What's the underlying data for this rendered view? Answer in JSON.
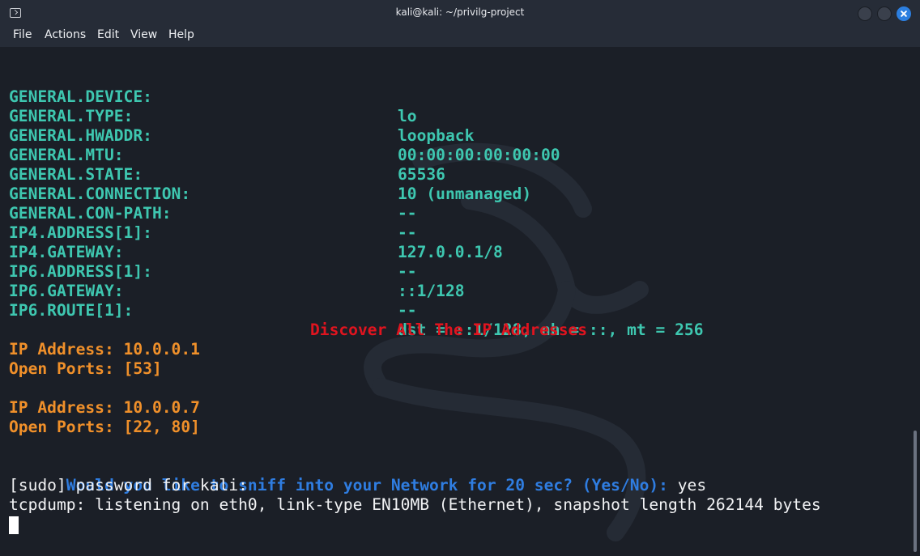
{
  "window": {
    "title": "kali@kali: ~/privilg-project",
    "icon": "terminal-icon"
  },
  "menu": [
    "File",
    "Actions",
    "Edit",
    "View",
    "Help"
  ],
  "device_info": [
    {
      "key": "GENERAL.DEVICE:",
      "value": "lo"
    },
    {
      "key": "GENERAL.TYPE:",
      "value": "loopback"
    },
    {
      "key": "GENERAL.HWADDR:",
      "value": "00:00:00:00:00:00"
    },
    {
      "key": "GENERAL.MTU:",
      "value": "65536"
    },
    {
      "key": "GENERAL.STATE:",
      "value": "10 (unmanaged)"
    },
    {
      "key": "GENERAL.CONNECTION:",
      "value": "--"
    },
    {
      "key": "GENERAL.CON-PATH:",
      "value": "--"
    },
    {
      "key": "IP4.ADDRESS[1]:",
      "value": "127.0.0.1/8"
    },
    {
      "key": "IP4.GATEWAY:",
      "value": "--"
    },
    {
      "key": "IP6.ADDRESS[1]:",
      "value": "::1/128"
    },
    {
      "key": "IP6.GATEWAY:",
      "value": "--"
    },
    {
      "key": "IP6.ROUTE[1]:",
      "value": "dst = ::1/128, nh = ::, mt = 256"
    }
  ],
  "discover_heading": "Discover All The IP Addresses",
  "hosts": [
    {
      "address": "IP Address: 10.0.0.1",
      "ports": "Open Ports: [53]"
    },
    {
      "address": "IP Address: 10.0.0.7",
      "ports": "Open Ports: [22, 80]"
    }
  ],
  "prompt": {
    "question": "Would you like to sniff into your Network for 20 sec? (Yes/No):",
    "answer": " yes"
  },
  "output_lines": [
    "[sudo] password for kali:",
    "tcpdump: listening on eth0, link-type EN10MB (Ethernet), snapshot length 262144 bytes"
  ],
  "colors": {
    "key_value": "#3ec7b0",
    "host": "#f0902a",
    "heading": "#e0141f",
    "prompt": "#2f7de1",
    "close_button": "#2c7fe0"
  }
}
